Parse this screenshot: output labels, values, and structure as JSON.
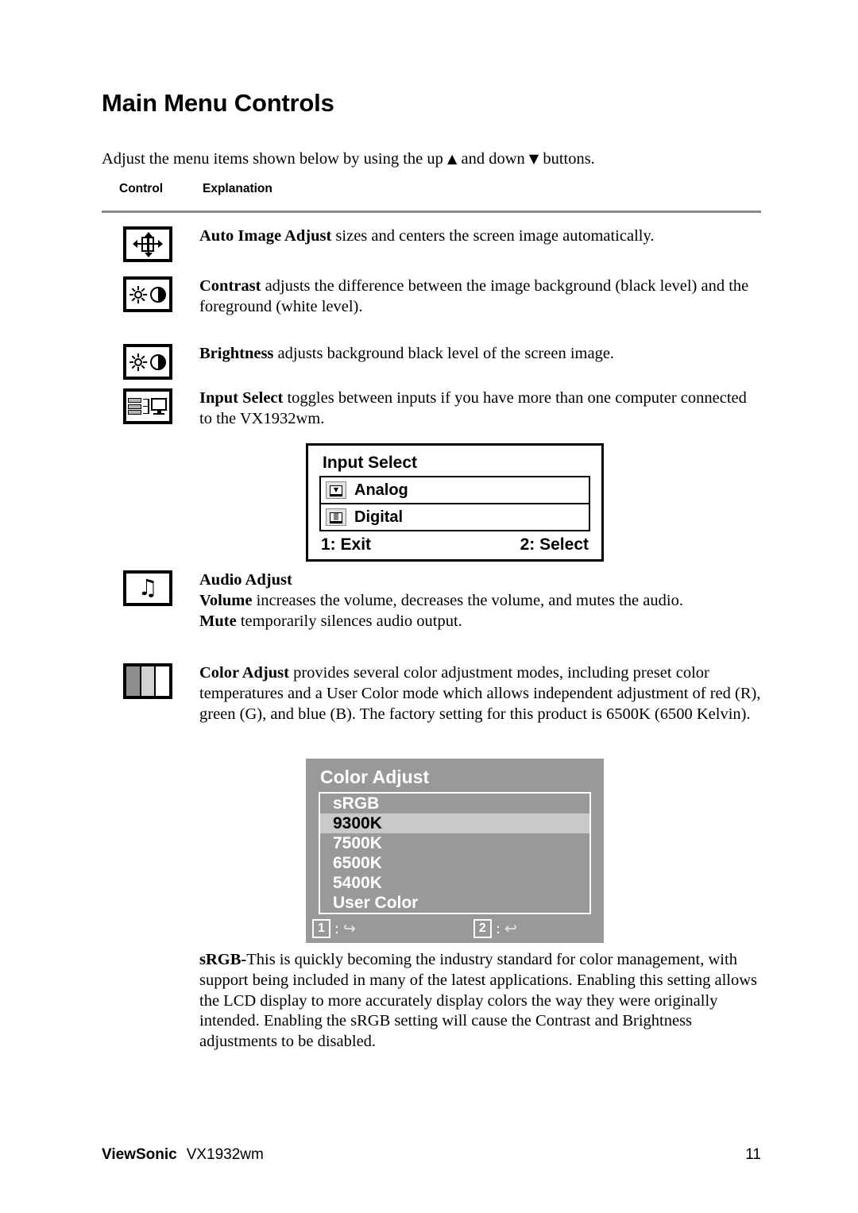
{
  "heading": "Main Menu Controls",
  "intro": {
    "before_up": "Adjust the menu items shown below by using the up ",
    "up_glyph": "▲",
    "between": " and down ",
    "down_glyph": "▼",
    "after": " buttons."
  },
  "columns": {
    "control": "Control",
    "explanation": "Explanation"
  },
  "rows": [
    {
      "icon": "auto-image-adjust-icon",
      "term": "Auto Image Adjust",
      "text": " sizes and centers the screen image automatically."
    },
    {
      "icon": "contrast-icon",
      "term": "Contrast",
      "text": " adjusts the difference between the image background  (black level) and the foreground (white level)."
    },
    {
      "icon": "brightness-icon",
      "term": "Brightness",
      "text": " adjusts background black level of the screen image."
    },
    {
      "icon": "input-select-icon",
      "term": "Input Select",
      "text": " toggles between inputs if you have more than one computer connected to the VX1932wm."
    },
    {
      "icon": "audio-adjust-icon",
      "heading": "Audio Adjust",
      "term_volume": "Volume",
      "text_volume": " increases the volume, decreases the volume, and mutes the audio.",
      "term_mute": "Mute",
      "text_mute": " temporarily silences audio output."
    },
    {
      "icon": "color-adjust-icon",
      "term": "Color Adjust",
      "text": " provides several color adjustment modes, including preset color temperatures and a User Color mode which allows independent adjustment of red (R), green (G), and blue (B). The factory setting for this product is 6500K (6500 Kelvin)."
    }
  ],
  "osd_input_select": {
    "title": "Input Select",
    "options": [
      {
        "label": "Analog",
        "icon": "analog-monitor-icon",
        "glyph": "▼"
      },
      {
        "label": "Digital",
        "icon": "digital-monitor-icon",
        "glyph": "▒"
      }
    ],
    "footer_left": "1: Exit",
    "footer_right": "2: Select"
  },
  "osd_color_adjust": {
    "title": "Color Adjust",
    "options": [
      {
        "label": "sRGB",
        "selected": false
      },
      {
        "label": "9300K",
        "selected": true
      },
      {
        "label": "7500K",
        "selected": false
      },
      {
        "label": "6500K",
        "selected": false
      },
      {
        "label": "5400K",
        "selected": false
      },
      {
        "label": "User Color",
        "selected": false
      }
    ],
    "footer": [
      {
        "key": "1",
        "sep": ":",
        "glyph": "↪",
        "icon": "exit-icon"
      },
      {
        "key": "2",
        "sep": ":",
        "glyph": "↩",
        "icon": "select-icon"
      }
    ],
    "panel_bg": "#999999",
    "selected_bg": "#c9c9c9"
  },
  "srgb_paragraph": {
    "term": "sRGB-",
    "text": "This is quickly becoming the industry standard for color management, with support being included in many of the latest applications. Enabling this setting allows the LCD display to more accurately display colors the way they were originally intended. Enabling the sRGB setting will cause the Contrast and Brightness adjustments to be disabled."
  },
  "footer": {
    "brand": "ViewSonic",
    "model": "VX1932wm",
    "page": "11"
  }
}
